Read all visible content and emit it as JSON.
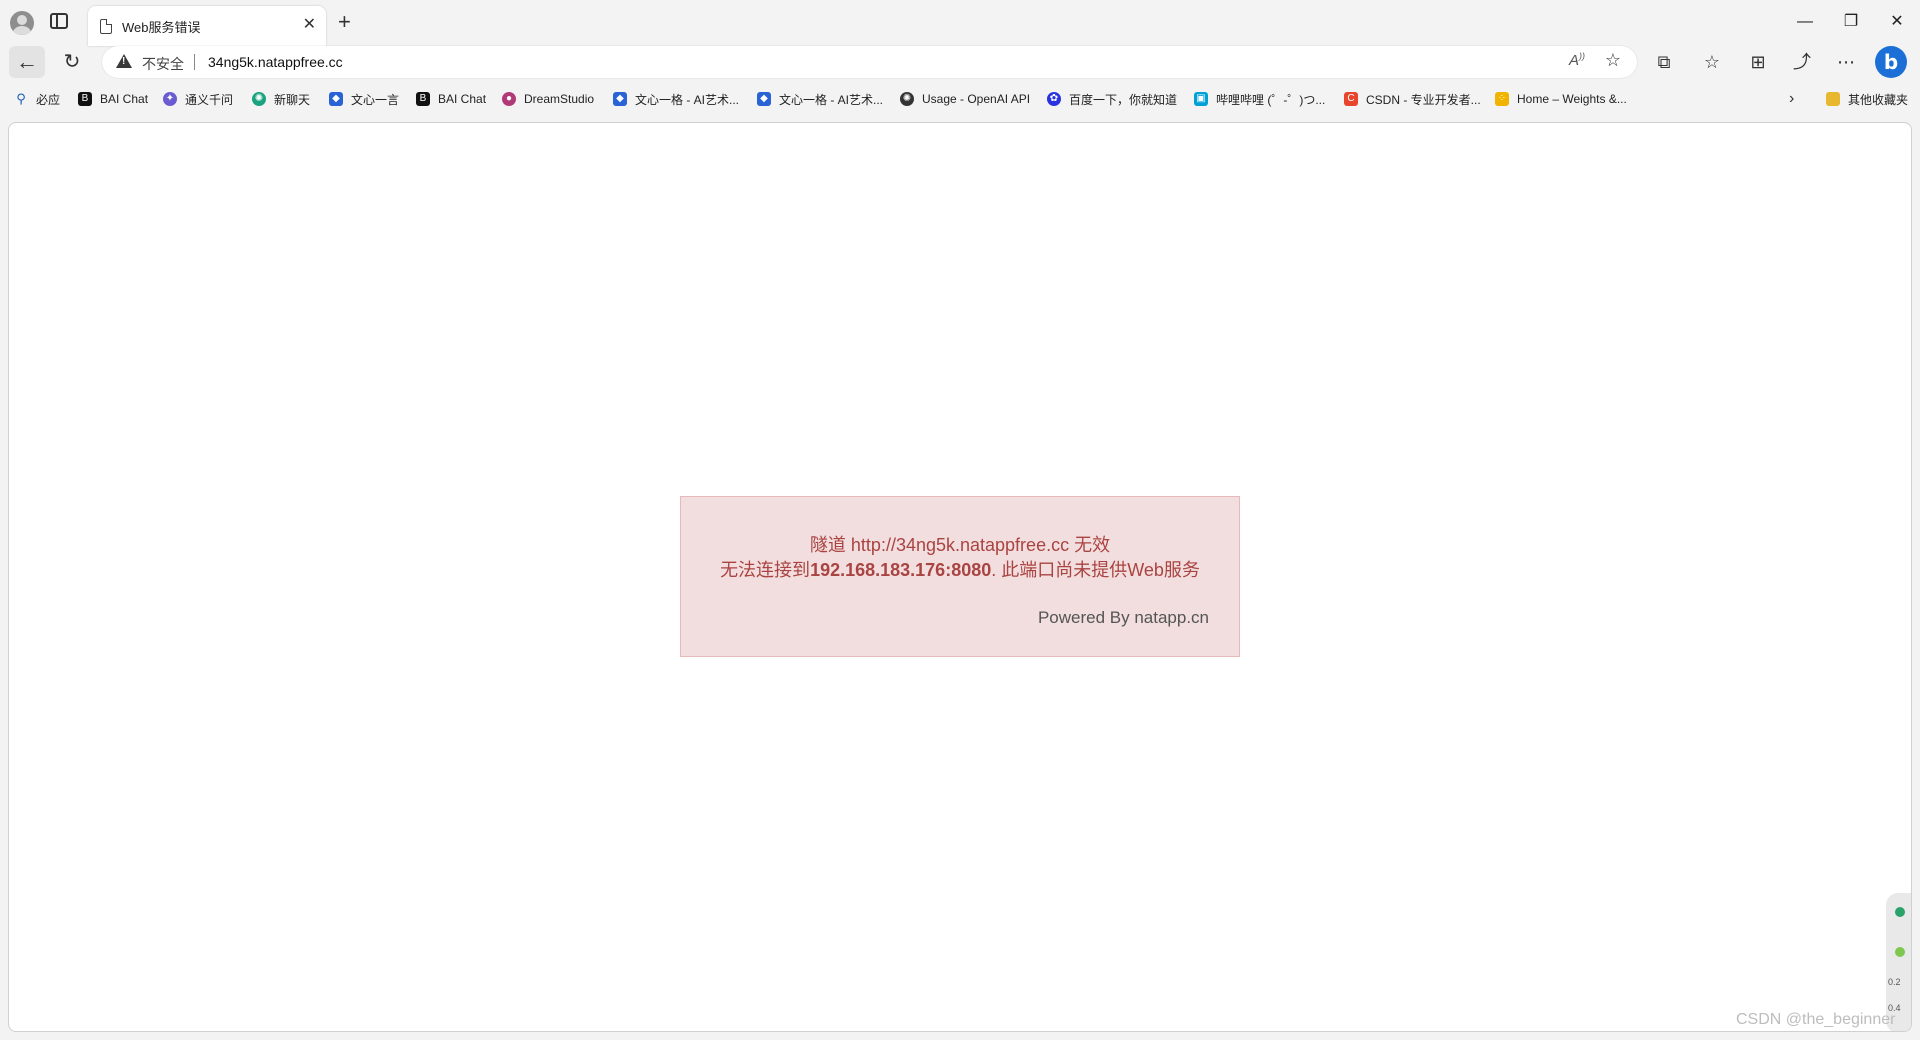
{
  "tab": {
    "title": "Web服务错误"
  },
  "address": {
    "security_label": "不安全",
    "url": "34ng5k.natappfree.cc"
  },
  "bookmarks": [
    {
      "label": "必应",
      "icon": "bing-search-icon",
      "color": "#1a5fb4"
    },
    {
      "label": "BAI Chat",
      "icon": "bai-chat-icon",
      "color": "#111111"
    },
    {
      "label": "通义千问",
      "icon": "tongyi-icon",
      "color": "#6b5bd2"
    },
    {
      "label": "新聊天",
      "icon": "openai-icon",
      "color": "#19a37f"
    },
    {
      "label": "文心一言",
      "icon": "wenxin-icon",
      "color": "#2a63d4"
    },
    {
      "label": "BAI Chat",
      "icon": "bai-chat-icon",
      "color": "#111111"
    },
    {
      "label": "DreamStudio",
      "icon": "dreamstudio-icon",
      "color": "#b03a78"
    },
    {
      "label": "文心一格 - AI艺术...",
      "icon": "wenxin-yige-icon",
      "color": "#2a63d4"
    },
    {
      "label": "文心一格 - AI艺术...",
      "icon": "wenxin-yige-icon",
      "color": "#2a63d4"
    },
    {
      "label": "Usage - OpenAI API",
      "icon": "openai-icon",
      "color": "#333333"
    },
    {
      "label": "百度一下，你就知道",
      "icon": "baidu-icon",
      "color": "#2932e1"
    },
    {
      "label": "哔哩哔哩 (゜-゜)つ...",
      "icon": "bilibili-icon",
      "color": "#00a1d6"
    },
    {
      "label": "CSDN - 专业开发者...",
      "icon": "csdn-icon",
      "color": "#e8452c"
    },
    {
      "label": "Home – Weights &...",
      "icon": "wandb-icon",
      "color": "#f0b400"
    }
  ],
  "other_favorites": "其他收藏夹",
  "error": {
    "line1": "隧道 http://34ng5k.natappfree.cc 无效",
    "line2_prefix": "无法连接到",
    "line2_address": "192.168.183.176:8080",
    "line2_suffix": ". 此端口尚未提供Web服务",
    "powered": "Powered By natapp.cn"
  },
  "widget": {
    "value1": "0.2",
    "value2": "0.4"
  },
  "watermark": "CSDN @the_beginner"
}
